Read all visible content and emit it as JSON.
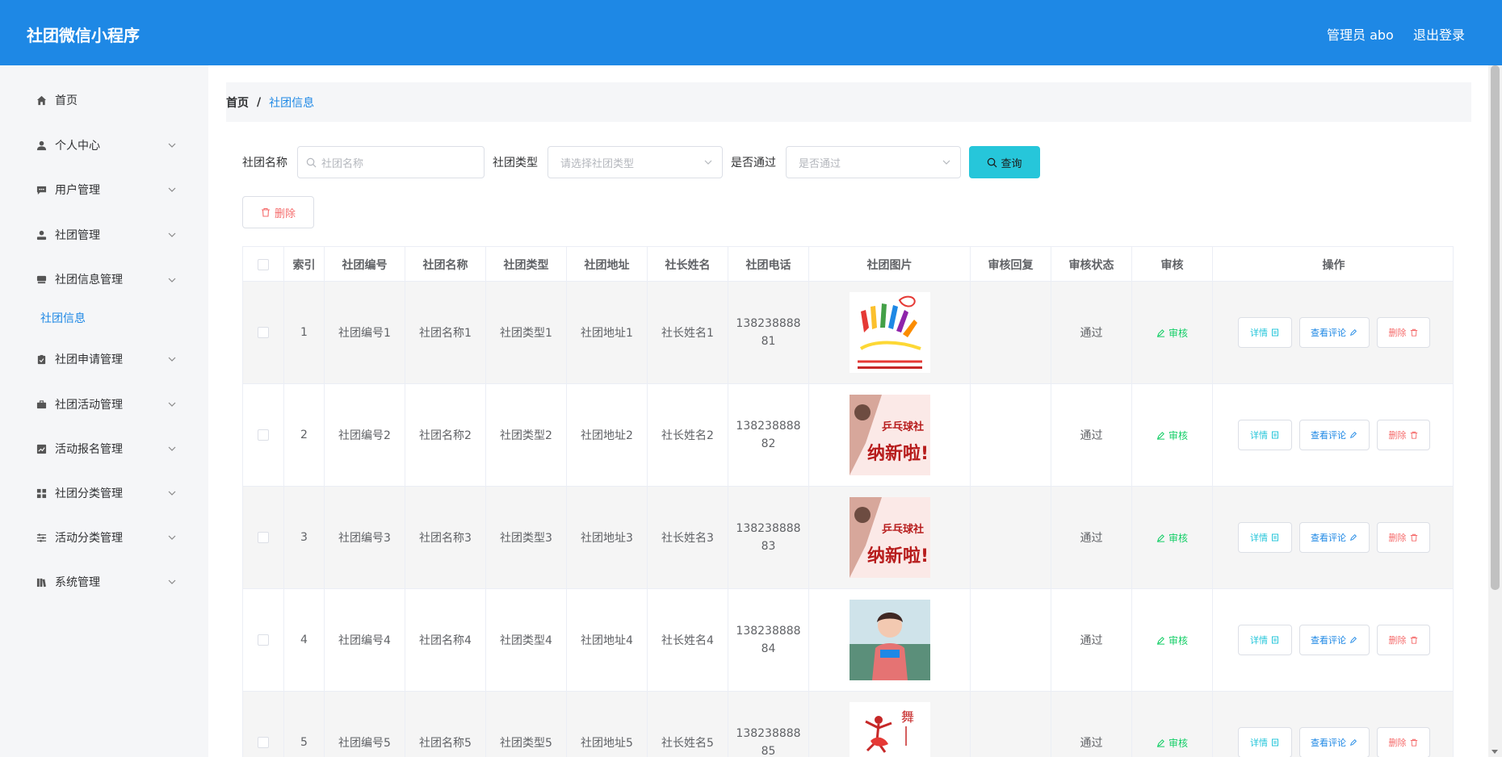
{
  "header": {
    "app_title": "社团微信小程序",
    "admin_label": "管理员 abo",
    "logout_label": "退出登录"
  },
  "sidebar": {
    "items": [
      {
        "label": "首页",
        "icon": "home-icon",
        "expandable": false
      },
      {
        "label": "个人中心",
        "icon": "user-icon",
        "expandable": true
      },
      {
        "label": "用户管理",
        "icon": "chat-icon",
        "expandable": true
      },
      {
        "label": "社团管理",
        "icon": "user-badge-icon",
        "expandable": true
      },
      {
        "label": "社团信息管理",
        "icon": "drive-icon",
        "expandable": true
      },
      {
        "label": "社团申请管理",
        "icon": "clipboard-icon",
        "expandable": true
      },
      {
        "label": "社团活动管理",
        "icon": "briefcase-icon",
        "expandable": true
      },
      {
        "label": "活动报名管理",
        "icon": "chart-icon",
        "expandable": true
      },
      {
        "label": "社团分类管理",
        "icon": "grid-icon",
        "expandable": true
      },
      {
        "label": "活动分类管理",
        "icon": "sliders-icon",
        "expandable": true
      },
      {
        "label": "系统管理",
        "icon": "books-icon",
        "expandable": true
      }
    ],
    "sub_item": "社团信息"
  },
  "breadcrumb": {
    "home": "首页",
    "separator": "/",
    "current": "社团信息"
  },
  "search": {
    "name_label": "社团名称",
    "name_placeholder": "社团名称",
    "type_label": "社团类型",
    "type_placeholder": "请选择社团类型",
    "pass_label": "是否通过",
    "pass_placeholder": "是否通过",
    "query_label": "查询"
  },
  "actions": {
    "delete_label": "删除"
  },
  "table": {
    "columns": [
      "",
      "索引",
      "社团编号",
      "社团名称",
      "社团类型",
      "社团地址",
      "社长姓名",
      "社团电话",
      "社团图片",
      "审核回复",
      "审核状态",
      "审核",
      "操作"
    ],
    "rows": [
      {
        "index": "1",
        "code": "社团编号1",
        "name": "社团名称1",
        "type": "社团类型1",
        "address": "社团地址1",
        "leader": "社长姓名1",
        "phone_a": "138238888",
        "phone_b": "81",
        "image": "volunteer-hands-poster",
        "reply": "",
        "status": "通过"
      },
      {
        "index": "2",
        "code": "社团编号2",
        "name": "社团名称2",
        "type": "社团类型2",
        "address": "社团地址2",
        "leader": "社长姓名2",
        "phone_a": "138238888",
        "phone_b": "82",
        "image": "pingpong-recruit-poster",
        "reply": "",
        "status": "通过"
      },
      {
        "index": "3",
        "code": "社团编号3",
        "name": "社团名称3",
        "type": "社团类型3",
        "address": "社团地址3",
        "leader": "社长姓名3",
        "phone_a": "138238888",
        "phone_b": "83",
        "image": "pingpong-recruit-poster",
        "reply": "",
        "status": "通过"
      },
      {
        "index": "4",
        "code": "社团编号4",
        "name": "社团名称4",
        "type": "社团类型4",
        "address": "社团地址4",
        "leader": "社长姓名4",
        "phone_a": "138238888",
        "phone_b": "84",
        "image": "girl-photo",
        "reply": "",
        "status": "通过"
      },
      {
        "index": "5",
        "code": "社团编号5",
        "name": "社团名称5",
        "type": "社团类型5",
        "address": "社团地址5",
        "leader": "社长姓名5",
        "phone_a": "138238888",
        "phone_b": "85",
        "image": "dance-poster",
        "reply": "",
        "status": "通过"
      }
    ],
    "audit_label": "审核",
    "detail_label": "详情",
    "comment_label": "查看评论",
    "row_delete_label": "删除",
    "image_texts": {
      "pingpong_club": "乒乓球社",
      "pingpong_slogan": "纳新啦!"
    }
  },
  "colors": {
    "primary": "#1e88e5",
    "query": "#26c6da",
    "audit": "#13ce66",
    "danger": "#f56c6c"
  }
}
